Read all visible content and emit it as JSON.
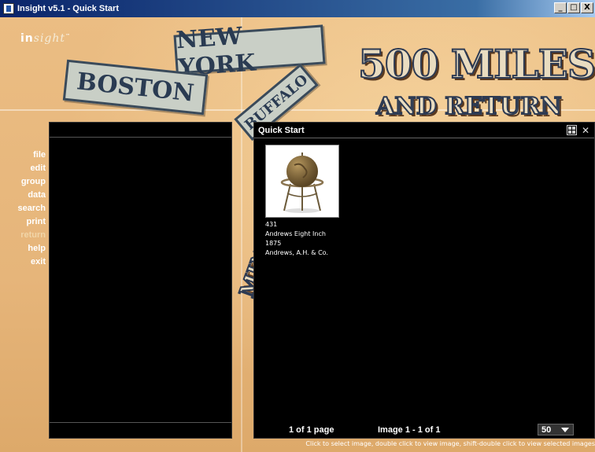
{
  "window": {
    "title": "Insight v5.1 - Quick Start",
    "buttons": {
      "minimize": "_",
      "maximize": "□",
      "close": "X"
    }
  },
  "logo": {
    "prefix": "in",
    "italic": "sight",
    "mark": "™"
  },
  "background": {
    "banner_1": "NEW YORK",
    "banner_2": "BOSTON",
    "banner_3": "BUFFALO",
    "headline_1": "500 MILES",
    "headline_2": "AND RETURN",
    "partial_word": "MIN"
  },
  "menu": {
    "items": [
      {
        "label": "file",
        "enabled": true
      },
      {
        "label": "edit",
        "enabled": true
      },
      {
        "label": "group",
        "enabled": true
      },
      {
        "label": "data",
        "enabled": true
      },
      {
        "label": "search",
        "enabled": true
      },
      {
        "label": "print",
        "enabled": true
      },
      {
        "label": "return",
        "enabled": false
      },
      {
        "label": "help",
        "enabled": true
      },
      {
        "label": "exit",
        "enabled": true
      }
    ]
  },
  "quick_start": {
    "title": "Quick Start",
    "items": [
      {
        "id": "431",
        "title": "Andrews Eight Inch",
        "date": "1875",
        "creator": "Andrews, A.H. & Co."
      }
    ],
    "footer": {
      "pages": "1 of 1 page",
      "range": "Image 1 - 1 of 1",
      "per_page": "50"
    },
    "hint": "Click to select image, double click to view image, shift-double click to view selected images"
  },
  "colors": {
    "accent_titlebar": "#0a246a",
    "panel_bg": "#000000",
    "background_parchment": "#e6b57a"
  }
}
